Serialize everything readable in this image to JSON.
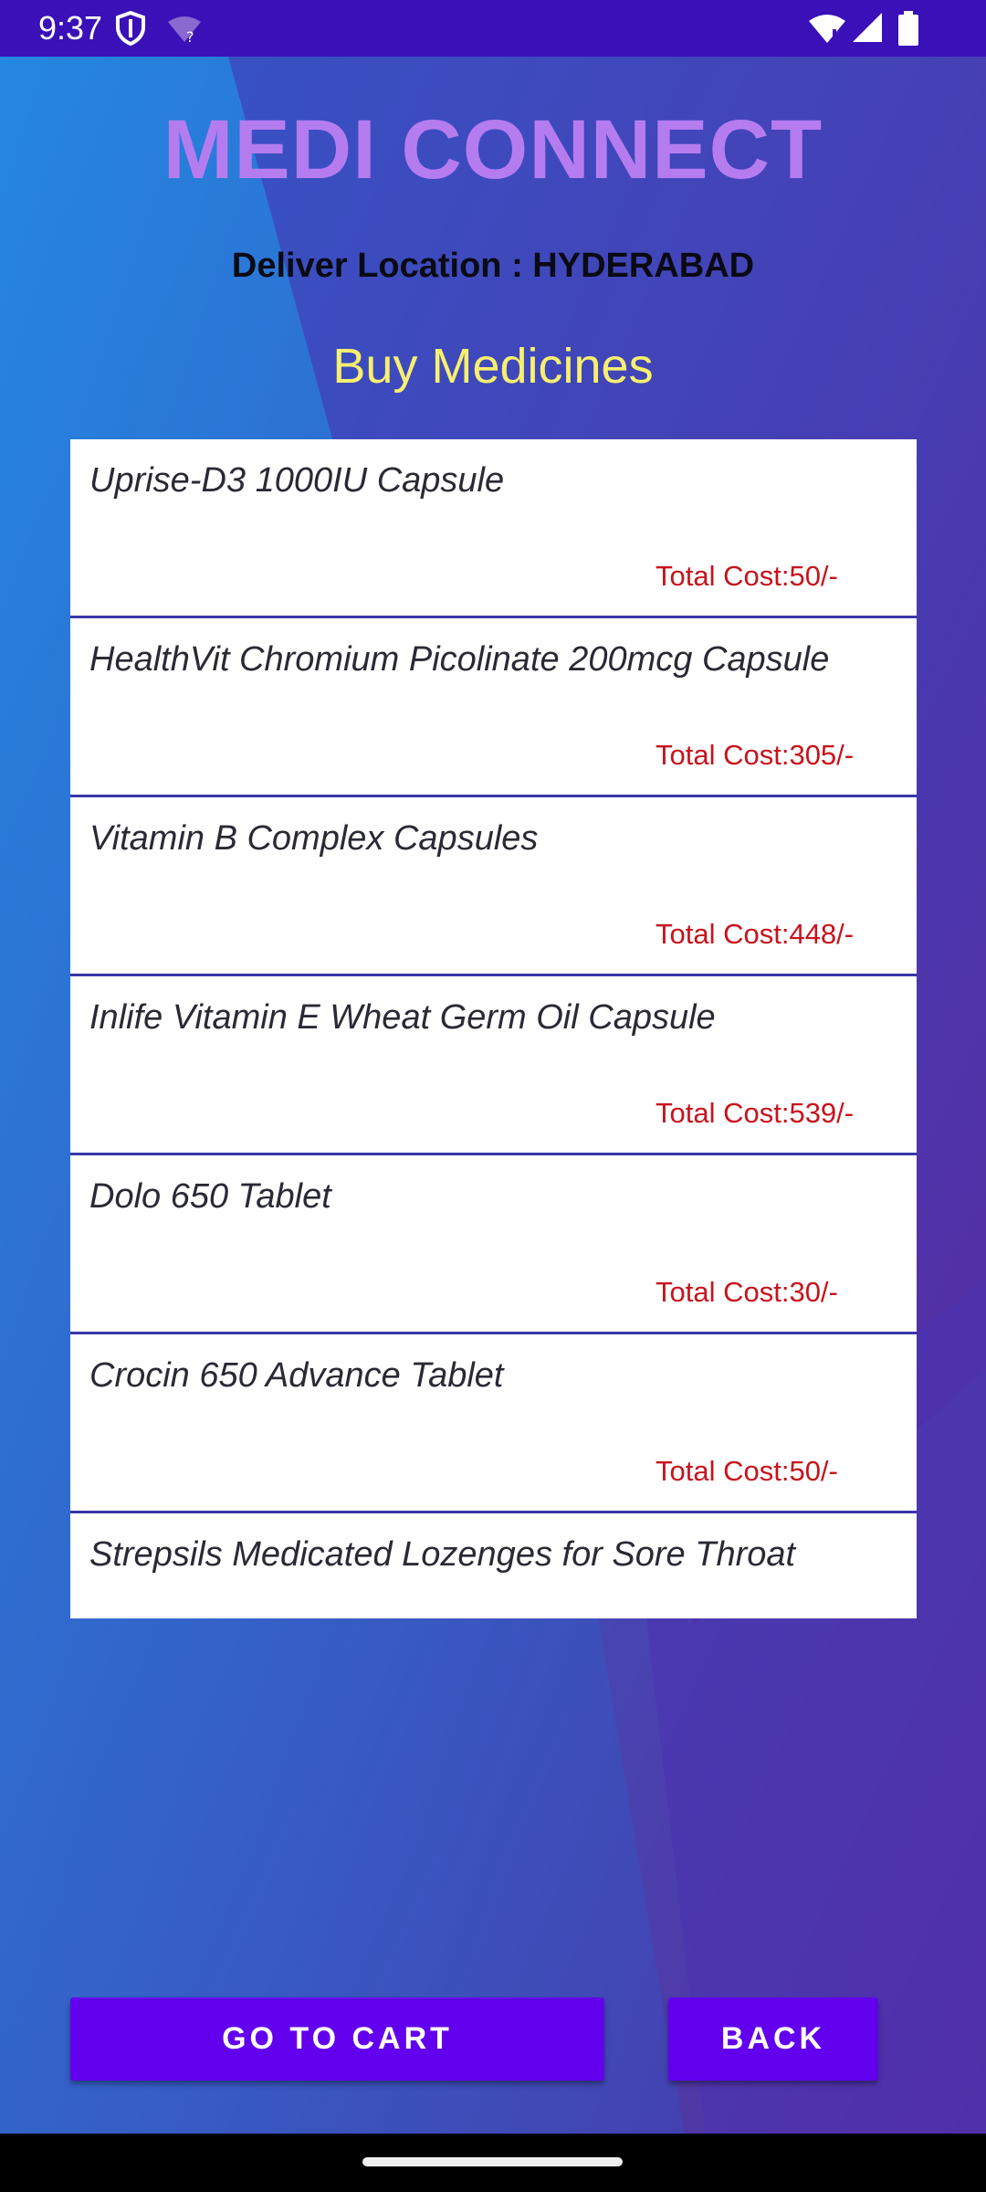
{
  "status_bar": {
    "time": "9:37"
  },
  "header": {
    "app_title": "MEDI CONNECT",
    "deliver_location": "Deliver Location : HYDERABAD",
    "section_title": "Buy Medicines"
  },
  "medicines": [
    {
      "name": "Uprise-D3 1000IU Capsule",
      "cost": "Total Cost:50/-"
    },
    {
      "name": "HealthVit Chromium Picolinate 200mcg Capsule",
      "cost": "Total Cost:305/-"
    },
    {
      "name": "Vitamin B Complex Capsules",
      "cost": "Total Cost:448/-"
    },
    {
      "name": "Inlife Vitamin E Wheat Germ Oil Capsule",
      "cost": "Total Cost:539/-"
    },
    {
      "name": "Dolo 650 Tablet",
      "cost": "Total Cost:30/-"
    },
    {
      "name": "Crocin 650 Advance Tablet",
      "cost": "Total Cost:50/-"
    },
    {
      "name": "Strepsils Medicated Lozenges for Sore Throat",
      "cost": ""
    }
  ],
  "buttons": {
    "go_to_cart": "GO TO CART",
    "back": "BACK"
  },
  "icons": {
    "status_left": [
      "shield-icon",
      "wifi-question-icon"
    ],
    "status_right": [
      "wifi-icon",
      "signal-icon",
      "battery-icon"
    ]
  },
  "colors": {
    "title": "#b57cf0",
    "section_title": "#f7ef6f",
    "cost": "#c8131c",
    "button": "#6200ee",
    "status_bar": "#3a10b8"
  }
}
